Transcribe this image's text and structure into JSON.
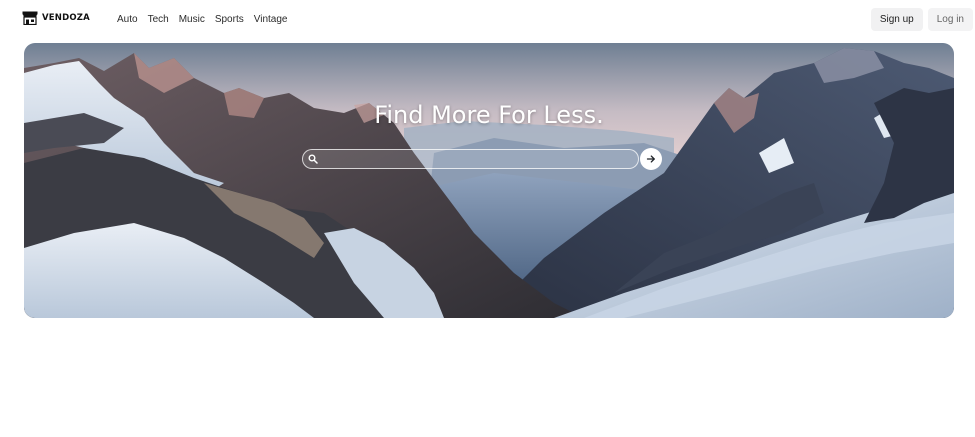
{
  "brand": {
    "name": "VENDOZA",
    "icon": "storefront-icon"
  },
  "nav": {
    "links": [
      {
        "label": "Auto"
      },
      {
        "label": "Tech"
      },
      {
        "label": "Music"
      },
      {
        "label": "Sports"
      },
      {
        "label": "Vintage"
      }
    ]
  },
  "auth": {
    "signup_label": "Sign up",
    "login_label": "Log in"
  },
  "hero": {
    "image": "snowy-mountain-range-photo",
    "title": "Find More For Less.",
    "search": {
      "value": "",
      "placeholder": "",
      "icon": "search-icon",
      "submit_icon": "arrow-right-icon"
    }
  },
  "colors": {
    "page_background": "#ffffff",
    "button_background": "#f1f1f2",
    "hero_title": "#ffffff"
  }
}
